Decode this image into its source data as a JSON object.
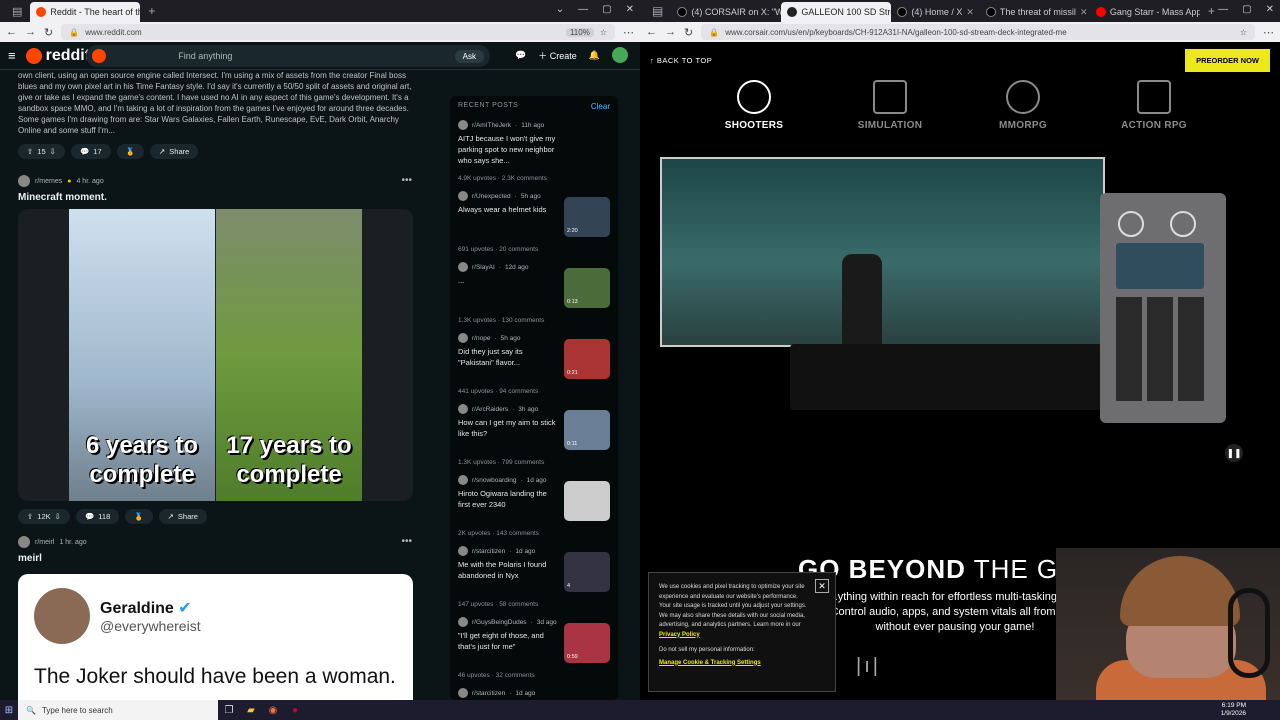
{
  "left_browser": {
    "tabs": [
      {
        "label": "Reddit - The heart of the intern"
      }
    ],
    "url": "www.reddit.com",
    "zoom": "110%"
  },
  "right_browser": {
    "tabs": [
      {
        "label": "(4) CORSAIR on X: \"Wh"
      },
      {
        "label": "GALLEON 100 SD Strea"
      },
      {
        "label": "(4) Home / X"
      },
      {
        "label": "The threat of missil"
      },
      {
        "label": "Gang Starr - Mass Appe"
      }
    ],
    "url": "www.corsair.com/us/en/p/keyboards/CH-912A31I-NA/galleon-100-sd-stream-deck-integrated-me"
  },
  "reddit": {
    "logo": "reddit",
    "search_placeholder": "Find anything",
    "ask": "Ask",
    "create": "Create",
    "chat_badge": "1",
    "post1_text": "own client, using an open source engine called Intersect. I'm using a mix of assets from the creator Final boss blues and my own pixel art in his Time Fantasy style. I'd say it's currently a 50/50 split of assets and original art, give or take as I expand the game's content. I have used no AI in any aspect of this game's development. It's a sandbox space MMO, and I'm taking a lot of inspiration from the games I've enjoyed for around three decades. Some games I'm drawing from are: Star Wars Galaxies, Fallen Earth, Runescape, EvE, Dark Orbit, Anarchy Online and some stuff I'm...",
    "post1_votes": "15",
    "post1_comments": "17",
    "share": "Share",
    "post2_sub": "r/memes",
    "post2_time": "4 hr. ago",
    "post2_title": "Minecraft moment.",
    "post2_caption_left": "6 years to complete",
    "post2_caption_right": "17 years to complete",
    "post2_votes": "12K",
    "post2_comments": "118",
    "post3_sub": "r/meirl",
    "post3_time": "1 hr. ago",
    "post3_title": "meirl",
    "tweet_name": "Geraldine",
    "tweet_handle": "@everywhereist",
    "tweet_body": "The Joker should have been a woman. And she finally went insane",
    "recent_header": "RECENT POSTS",
    "clear": "Clear",
    "recent": [
      {
        "sub": "r/AmITheJerk",
        "time": "11h ago",
        "title": "AITJ because I won't give my parking spot to new neighbor who says she...",
        "stats": "4.9K upvotes · 2.3K comments",
        "dur": ""
      },
      {
        "sub": "r/Unexpected",
        "time": "5h ago",
        "title": "Always wear a helmet kids",
        "stats": "691 upvotes · 20 comments",
        "dur": "2:20"
      },
      {
        "sub": "r/SlayAI",
        "time": "12d ago",
        "title": "...",
        "stats": "1.3K upvotes · 130 comments",
        "dur": "0:13"
      },
      {
        "sub": "r/nope",
        "time": "5h ago",
        "title": "Did they just say its \"Pakistani\" flavor...",
        "stats": "441 upvotes · 94 comments",
        "dur": "0:21"
      },
      {
        "sub": "r/ArcRaiders",
        "time": "3h ago",
        "title": "How can I get my aim to stick like this?",
        "stats": "1.3K upvotes · 799 comments",
        "dur": "0:11"
      },
      {
        "sub": "r/snowboarding",
        "time": "1d ago",
        "title": "Hiroto Ogiwara landing the first ever 2340",
        "stats": "2K upvotes · 143 comments",
        "dur": ""
      },
      {
        "sub": "r/starcitizen",
        "time": "1d ago",
        "title": "Me with the Polaris I found abandoned in Nyx",
        "stats": "147 upvotes · 58 comments",
        "dur": "4"
      },
      {
        "sub": "r/GuysBeingDudes",
        "time": "3d ago",
        "title": "\"I'll get eight of those, and that's just for me\"",
        "stats": "46 upvotes · 32 comments",
        "dur": "0:59"
      },
      {
        "sub": "r/starcitizen",
        "time": "1d ago",
        "title": "Best Subscriber Flair in",
        "stats": "",
        "dur": ""
      }
    ]
  },
  "corsair": {
    "back": "BACK TO TOP",
    "preorder": "PREORDER NOW",
    "categories": [
      "SHOOTERS",
      "SIMULATION",
      "MMORPG",
      "ACTION RPG"
    ],
    "beyond_bold": "GO BEYOND",
    "beyond_rest": "THE GAM",
    "sub_copy": "...ything within reach for effortless multi-tasking an... Control audio, apps, and system vitals all from yo... without ever pausing your game!",
    "cookie_text": "We use cookies and pixel tracking to optimize your site experience and evaluate our website's performance. Your site usage is tracked until you adjust your settings. We may also share these details with our social media, advertising, and analytics partners. Learn more in our",
    "privacy": "Privacy Policy",
    "dnsell": "Do not sell my personal information:",
    "manage": "Manage Cookie & Tracking Settings"
  },
  "taskbar": {
    "search_placeholder": "Type here to search",
    "time": "6:19 PM",
    "date": "1/9/2026"
  }
}
